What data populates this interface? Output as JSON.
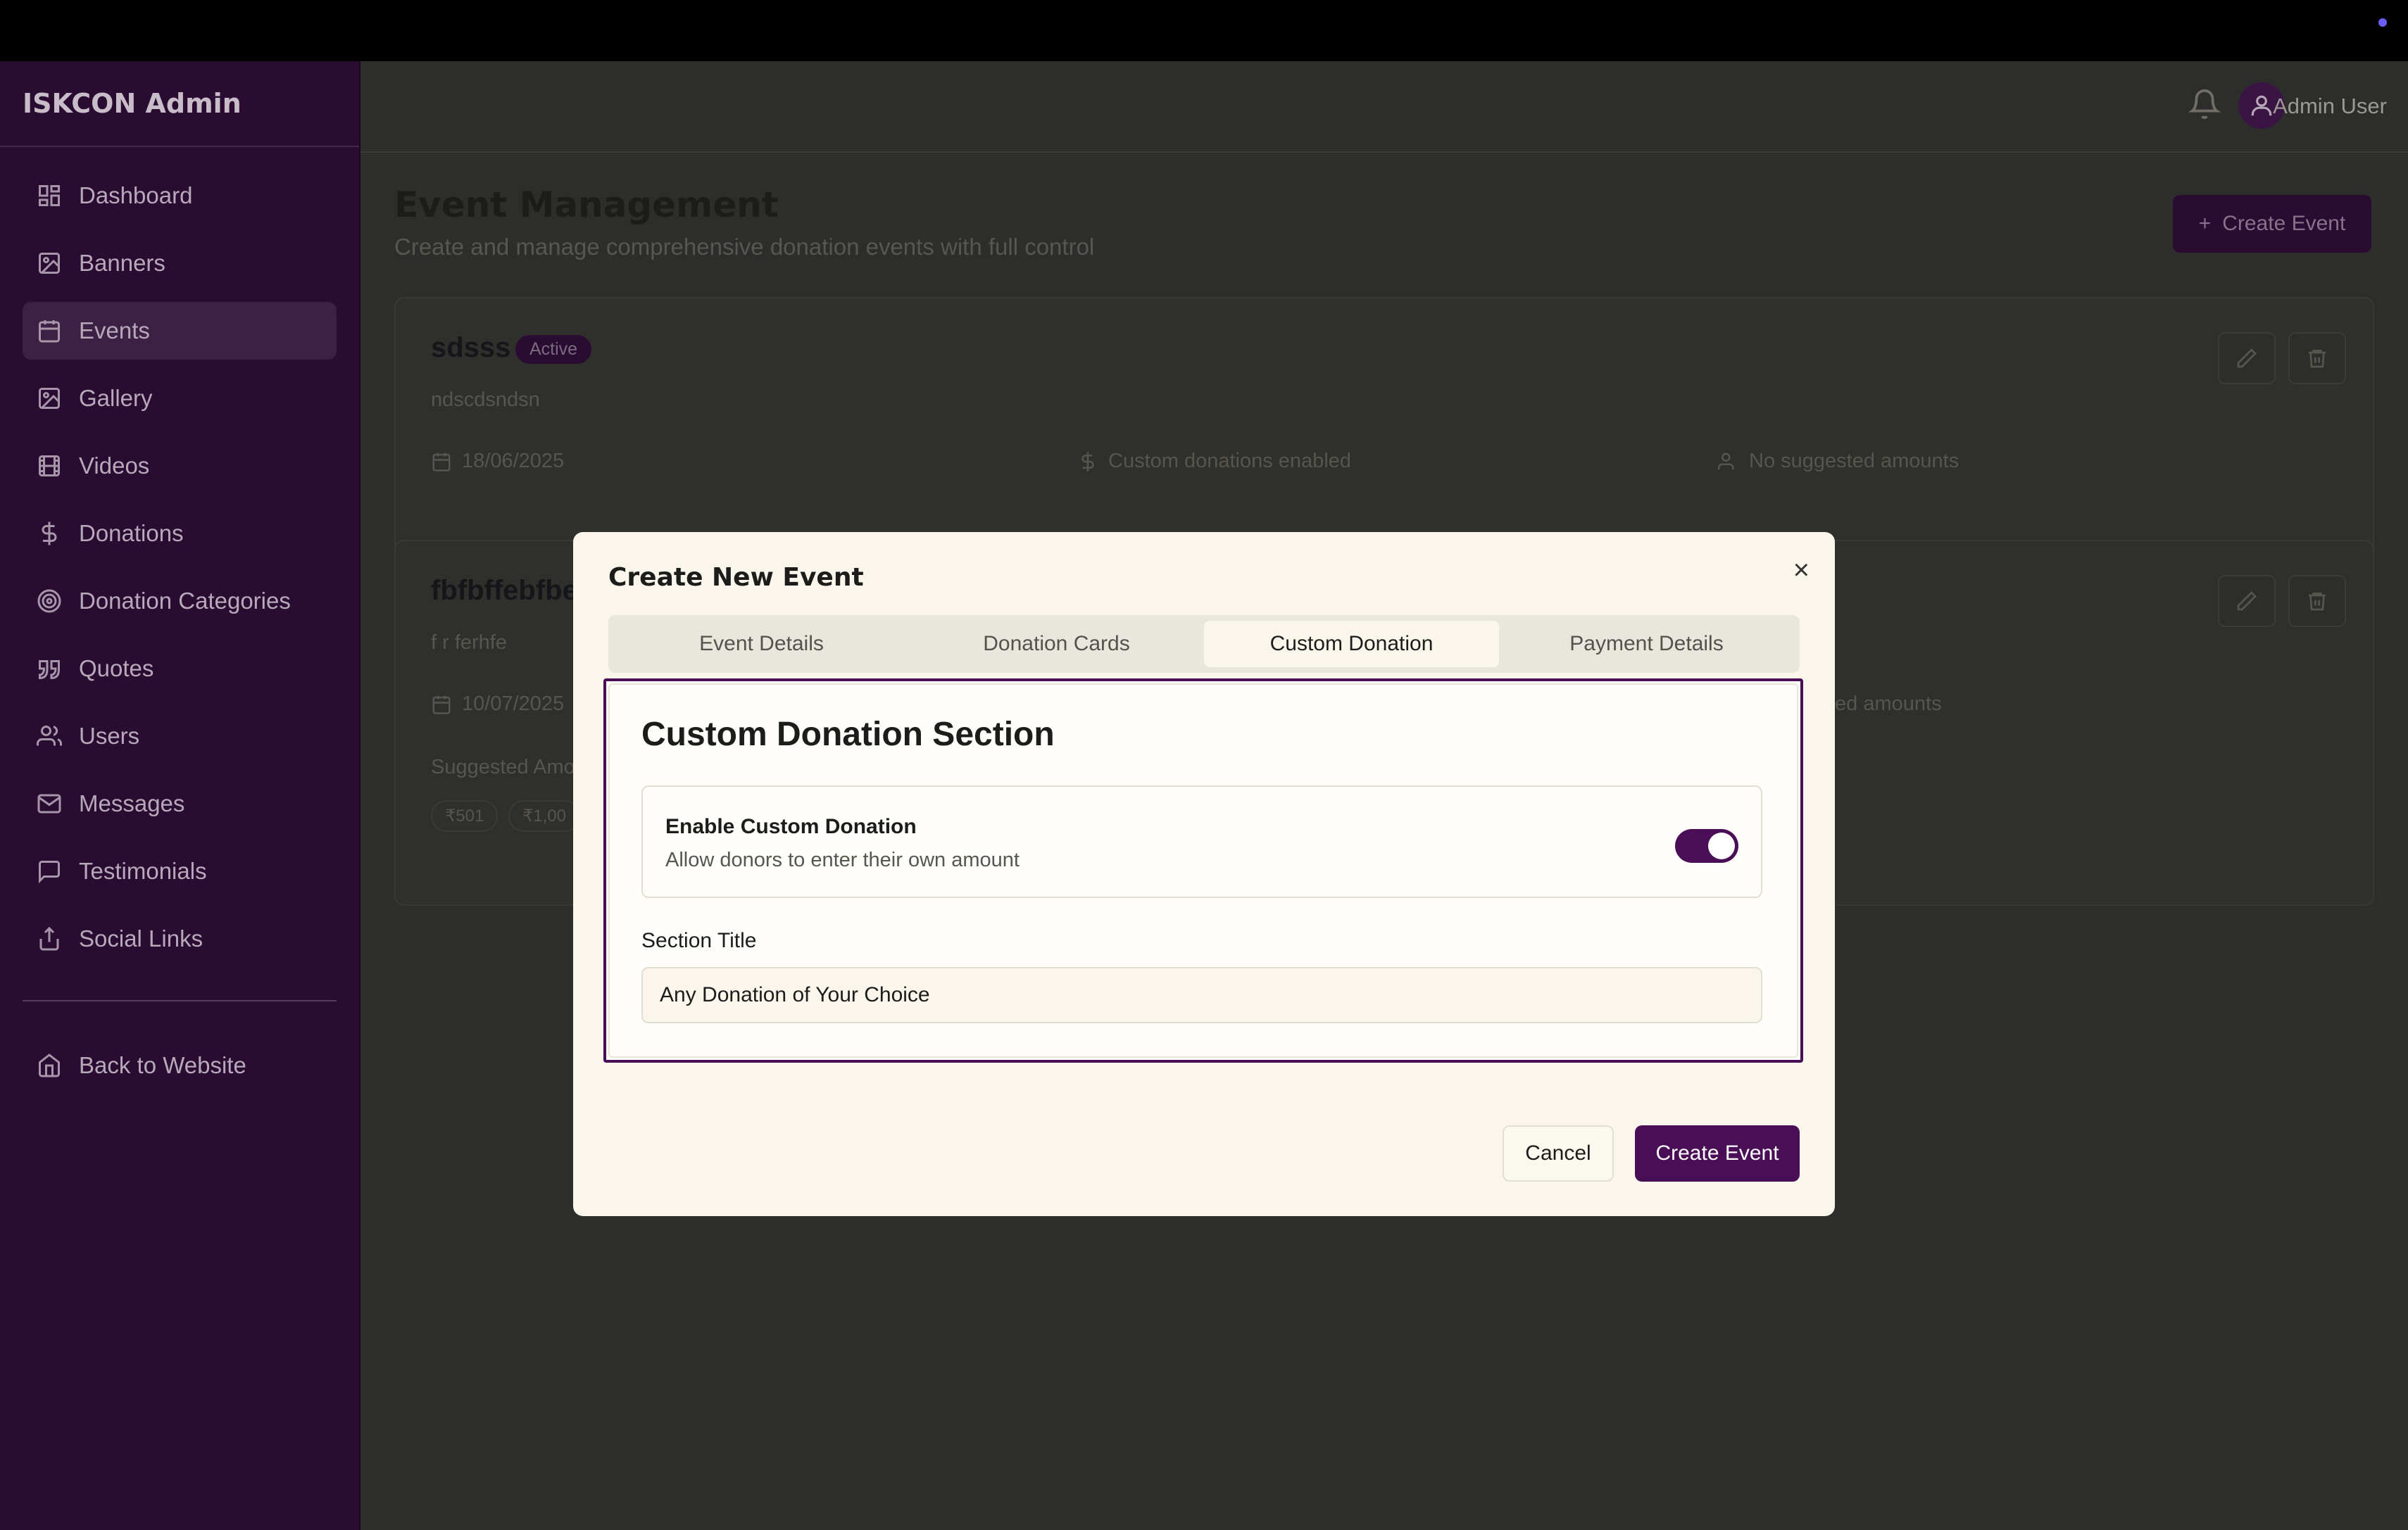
{
  "app": {
    "brand": "ISKCON Admin"
  },
  "sidebar": {
    "items": [
      {
        "label": "Dashboard",
        "icon": "dashboard-icon"
      },
      {
        "label": "Banners",
        "icon": "image-icon"
      },
      {
        "label": "Events",
        "icon": "calendar-icon",
        "active": true
      },
      {
        "label": "Gallery",
        "icon": "image-icon"
      },
      {
        "label": "Videos",
        "icon": "film-icon"
      },
      {
        "label": "Donations",
        "icon": "dollar-icon"
      },
      {
        "label": "Donation Categories",
        "icon": "target-icon"
      },
      {
        "label": "Quotes",
        "icon": "quote-icon"
      },
      {
        "label": "Users",
        "icon": "users-icon"
      },
      {
        "label": "Messages",
        "icon": "mail-icon"
      },
      {
        "label": "Testimonials",
        "icon": "message-icon"
      },
      {
        "label": "Social Links",
        "icon": "share-icon"
      }
    ],
    "back_label": "Back to Website"
  },
  "header": {
    "user_name": "Admin User"
  },
  "page": {
    "title": "Event Management",
    "subtitle": "Create and manage comprehensive donation events with full control",
    "create_button": "Create Event"
  },
  "events": [
    {
      "title": "sdsss",
      "status": "Active",
      "description": "ndscdsndsn",
      "date": "18/06/2025",
      "custom": "Custom donations enabled",
      "suggested": "No suggested amounts"
    },
    {
      "title": "fbfbffebfbe",
      "description": "f r ferhfe",
      "date": "10/07/2025",
      "suggested_fragment": "ted amounts",
      "suggested_label": "Suggested Amo",
      "chips": [
        "₹501",
        "₹1,00"
      ]
    }
  ],
  "modal": {
    "title": "Create New Event",
    "tabs": [
      "Event Details",
      "Donation Cards",
      "Custom Donation",
      "Payment Details"
    ],
    "active_tab": "Custom Donation",
    "section_title": "Custom Donation Section",
    "toggle": {
      "label": "Enable Custom Donation",
      "description": "Allow donors to enter their own amount",
      "enabled": true
    },
    "field_label": "Section Title",
    "field_value": "Any Donation of Your Choice",
    "cancel": "Cancel",
    "submit": "Create Event"
  },
  "colors": {
    "accent": "#4a0e57",
    "sidebar": "#2a0c33",
    "modal_bg": "#faf6ec"
  }
}
